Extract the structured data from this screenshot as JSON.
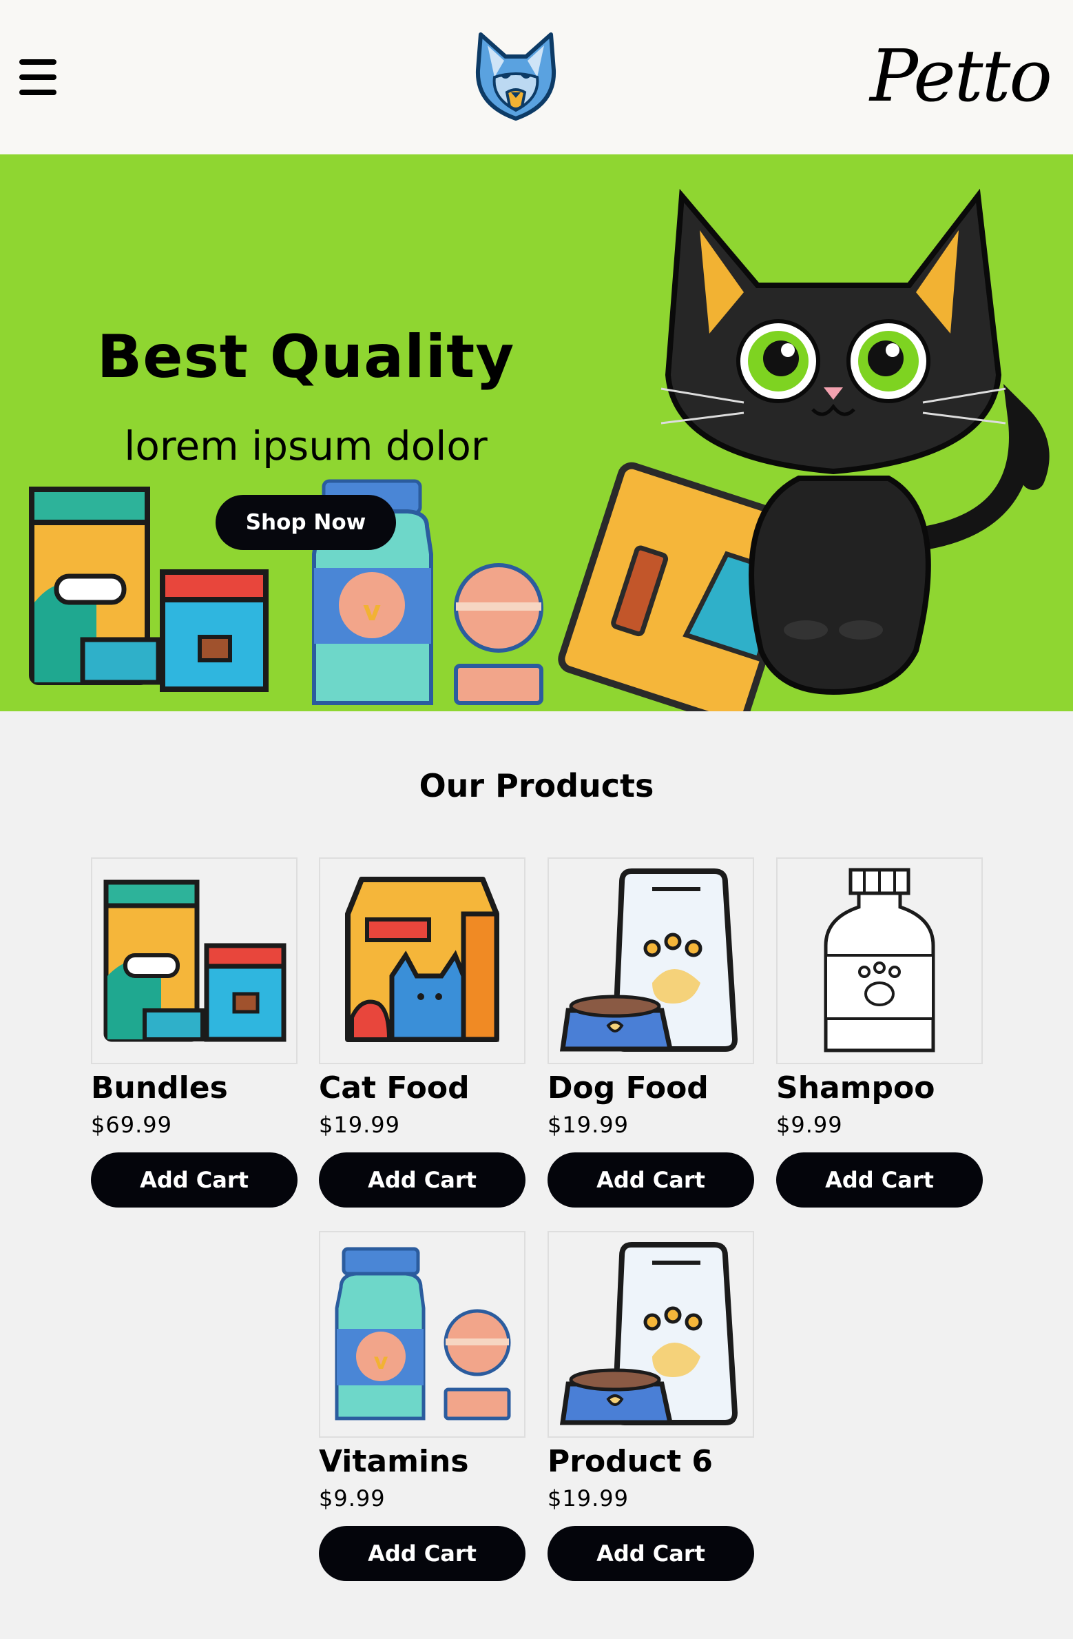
{
  "header": {
    "brand": "Petto",
    "menu_icon": "hamburger-menu-icon",
    "logo_icon": "dog-head-logo-icon"
  },
  "hero": {
    "title": "Best Quality",
    "subtitle": "lorem ipsum dolor",
    "cta_label": "Shop Now",
    "background": "#8fd631"
  },
  "products": {
    "title": "Our Products",
    "button_label": "Add Cart",
    "items": [
      {
        "name": "Bundles",
        "price": "$69.99",
        "icon": "bundle-icon"
      },
      {
        "name": "Cat Food",
        "price": "$19.99",
        "icon": "cat-food-bag-icon"
      },
      {
        "name": "Dog Food",
        "price": "$19.99",
        "icon": "dog-food-bag-icon"
      },
      {
        "name": "Shampoo",
        "price": "$9.99",
        "icon": "shampoo-bottle-icon"
      },
      {
        "name": "Vitamins",
        "price": "$9.99",
        "icon": "vitamins-icon"
      },
      {
        "name": "Product 6",
        "price": "$19.99",
        "icon": "dog-food-bag-icon"
      }
    ]
  }
}
